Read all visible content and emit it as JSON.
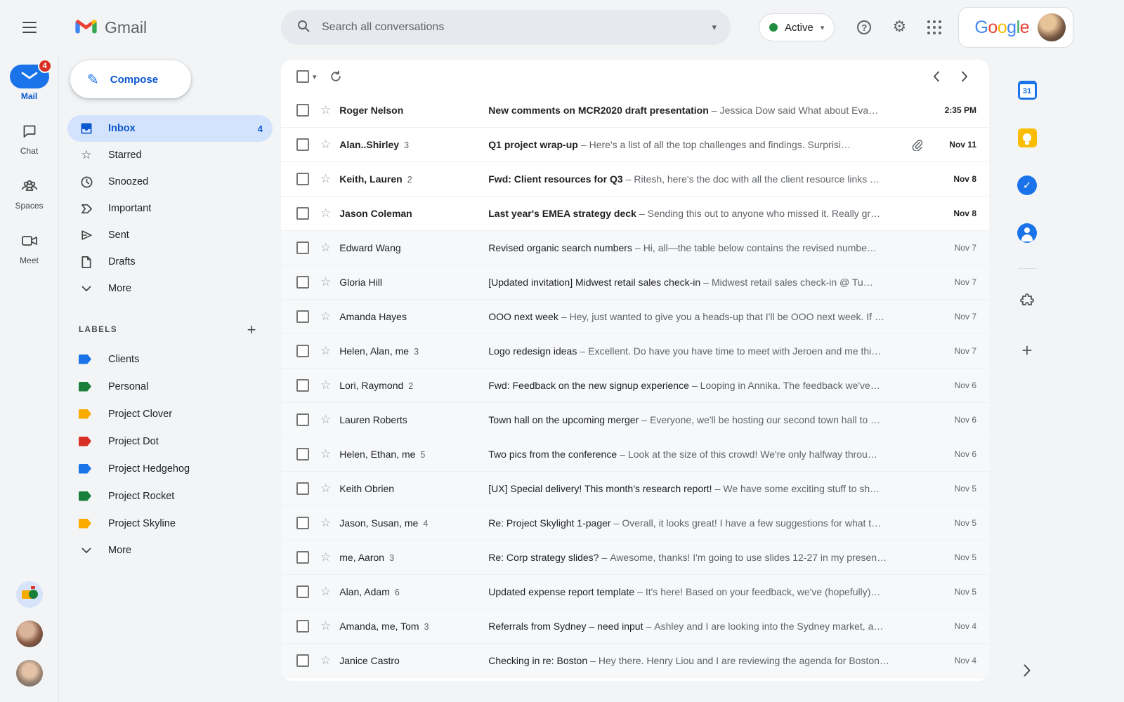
{
  "colors": {
    "accent_blue": "#1a73e8",
    "link_blue": "#0b57d0",
    "selected_pill": "#d3e3fd",
    "badge_red": "#d93025",
    "status_green": "#1e8e3e",
    "unread_text": "#202124",
    "muted_text": "#5f6368",
    "google_letters": [
      "#4285f4",
      "#ea4335",
      "#fbbc05",
      "#4285f4",
      "#34a853",
      "#ea4335"
    ]
  },
  "icons": {
    "gear": "⚙",
    "help": "?",
    "caret": "▾",
    "star": "☆",
    "plus": "+",
    "check": "✓",
    "compose_pencil": "✎"
  },
  "header": {
    "app_name": "Gmail",
    "search_placeholder": "Search all conversations",
    "status_label": "Active",
    "brand": "Google"
  },
  "rail": {
    "items": [
      {
        "label": "Mail",
        "badge": "4",
        "active": true
      },
      {
        "label": "Chat"
      },
      {
        "label": "Spaces"
      },
      {
        "label": "Meet"
      }
    ]
  },
  "sidebar": {
    "compose_label": "Compose",
    "folders": [
      {
        "label": "Inbox",
        "count": "4",
        "active": true
      },
      {
        "label": "Starred"
      },
      {
        "label": "Snoozed"
      },
      {
        "label": "Important"
      },
      {
        "label": "Sent"
      },
      {
        "label": "Drafts"
      },
      {
        "label": "More"
      }
    ],
    "labels_header": "Labels",
    "labels": [
      {
        "name": "Clients",
        "color": "#1a73e8"
      },
      {
        "name": "Personal",
        "color": "#188038"
      },
      {
        "name": "Project Clover",
        "color": "#f9ab00"
      },
      {
        "name": "Project Dot",
        "color": "#d93025"
      },
      {
        "name": "Project Hedgehog",
        "color": "#1a73e8"
      },
      {
        "name": "Project Rocket",
        "color": "#188038"
      },
      {
        "name": "Project Skyline",
        "color": "#f9ab00"
      }
    ],
    "labels_more": "More"
  },
  "list": {
    "separator": "–",
    "emails": [
      {
        "sender": "Roger Nelson",
        "count": "",
        "subject": "New comments on MCR2020 draft presentation",
        "snippet": "Jessica Dow said What about Eva…",
        "date": "2:35 PM",
        "unread": true,
        "attachment": false
      },
      {
        "sender": "Alan..Shirley",
        "count": "3",
        "subject": "Q1 project wrap-up",
        "snippet": "Here's a list of all the top challenges and findings. Surprisi…",
        "date": "Nov 11",
        "unread": true,
        "attachment": true
      },
      {
        "sender": "Keith, Lauren",
        "count": "2",
        "subject": "Fwd: Client resources for Q3",
        "snippet": "Ritesh, here's the doc with all the client resource links …",
        "date": "Nov 8",
        "unread": true,
        "attachment": false
      },
      {
        "sender": "Jason Coleman",
        "count": "",
        "subject": "Last year's EMEA strategy deck",
        "snippet": "Sending this out to anyone who missed it. Really gr…",
        "date": "Nov 8",
        "unread": true,
        "attachment": false
      },
      {
        "sender": "Edward Wang",
        "count": "",
        "subject": "Revised organic search numbers",
        "snippet": "Hi, all—the table below contains the revised numbe…",
        "date": "Nov 7",
        "unread": false,
        "attachment": false
      },
      {
        "sender": "Gloria Hill",
        "count": "",
        "subject": "[Updated invitation] Midwest retail sales check-in",
        "snippet": "Midwest retail sales check-in @ Tu…",
        "date": "Nov 7",
        "unread": false,
        "attachment": false
      },
      {
        "sender": "Amanda Hayes",
        "count": "",
        "subject": "OOO next week",
        "snippet": "Hey, just wanted to give you a heads-up that I'll be OOO next week. If …",
        "date": "Nov 7",
        "unread": false,
        "attachment": false
      },
      {
        "sender": "Helen, Alan, me",
        "count": "3",
        "subject": "Logo redesign ideas",
        "snippet": "Excellent. Do have you have time to meet with Jeroen and me thi…",
        "date": "Nov 7",
        "unread": false,
        "attachment": false
      },
      {
        "sender": "Lori, Raymond",
        "count": "2",
        "subject": "Fwd: Feedback on the new signup experience",
        "snippet": "Looping in Annika. The feedback we've…",
        "date": "Nov 6",
        "unread": false,
        "attachment": false
      },
      {
        "sender": "Lauren Roberts",
        "count": "",
        "subject": "Town hall on the upcoming merger",
        "snippet": "Everyone, we'll be hosting our second town hall to …",
        "date": "Nov 6",
        "unread": false,
        "attachment": false
      },
      {
        "sender": "Helen, Ethan, me",
        "count": "5",
        "subject": "Two pics from the conference",
        "snippet": "Look at the size of this crowd! We're only halfway throu…",
        "date": "Nov 6",
        "unread": false,
        "attachment": false
      },
      {
        "sender": "Keith Obrien",
        "count": "",
        "subject": "[UX] Special delivery! This month's research report!",
        "snippet": "We have some exciting stuff to sh…",
        "date": "Nov 5",
        "unread": false,
        "attachment": false
      },
      {
        "sender": "Jason, Susan, me",
        "count": "4",
        "subject": "Re: Project Skylight 1-pager",
        "snippet": "Overall, it looks great! I have a few suggestions for what t…",
        "date": "Nov 5",
        "unread": false,
        "attachment": false
      },
      {
        "sender": "me, Aaron",
        "count": "3",
        "subject": "Re: Corp strategy slides?",
        "snippet": "Awesome, thanks! I'm going to use slides 12-27 in my presen…",
        "date": "Nov 5",
        "unread": false,
        "attachment": false
      },
      {
        "sender": "Alan, Adam",
        "count": "6",
        "subject": "Updated expense report template",
        "snippet": "It's here! Based on your feedback, we've (hopefully)…",
        "date": "Nov 5",
        "unread": false,
        "attachment": false
      },
      {
        "sender": "Amanda, me, Tom",
        "count": "3",
        "subject": "Referrals from Sydney – need input",
        "snippet": "Ashley and I are looking into the Sydney market, a…",
        "date": "Nov 4",
        "unread": false,
        "attachment": false
      },
      {
        "sender": "Janice Castro",
        "count": "",
        "subject": "Checking in re: Boston",
        "snippet": "Hey there. Henry Liou and I are reviewing the agenda for Boston…",
        "date": "Nov 4",
        "unread": false,
        "attachment": false
      }
    ]
  },
  "sidepanel": {
    "calendar_text": "31"
  }
}
